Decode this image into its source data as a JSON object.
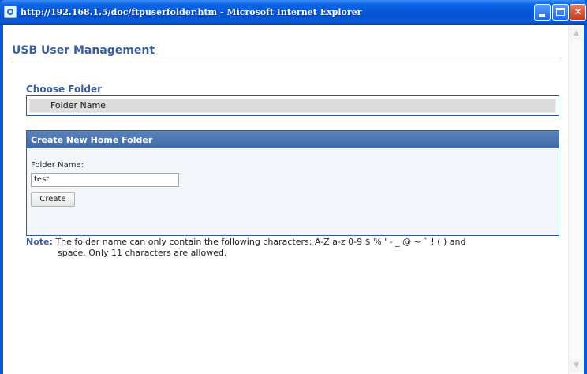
{
  "window": {
    "title": "http://192.168.1.5/doc/ftpuserfolder.htm - Microsoft Internet Explorer",
    "close_glyph": "✕"
  },
  "page": {
    "title": "USB User Management"
  },
  "choose_folder": {
    "heading": "Choose Folder",
    "column_header": "Folder Name"
  },
  "create_panel": {
    "heading": "Create New Home Folder",
    "field_label": "Folder Name:",
    "field_value": "test",
    "create_label": "Create"
  },
  "note": {
    "label": "Note:",
    "line1": "The folder name can only contain the following characters: A-Z a-z 0-9 $ % ' - _ @ ~ ` ! ( ) and",
    "line2": "space. Only 11 characters are allowed."
  },
  "scrollbar": {
    "up_glyph": "▲",
    "down_glyph": "▼"
  },
  "colors": {
    "titlebar": "#0a5ad8",
    "accent_text": "#3a5d9c",
    "panel_header": "#4a72b0",
    "panel_border": "#2e5da0"
  },
  "icons": [
    "ie-page-icon",
    "minimize-icon",
    "maximize-icon",
    "close-icon",
    "scroll-up-icon",
    "scroll-down-icon"
  ]
}
